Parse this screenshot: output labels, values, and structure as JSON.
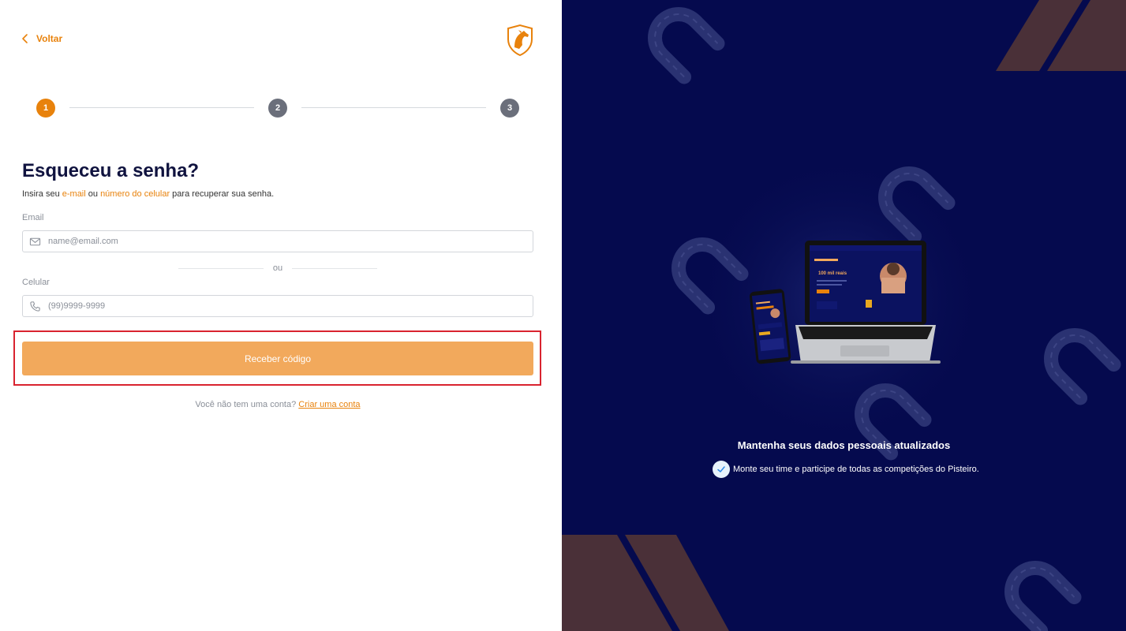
{
  "back": {
    "label": "Voltar"
  },
  "stepper": {
    "steps": [
      "1",
      "2",
      "3"
    ]
  },
  "form": {
    "title": "Esqueceu a senha?",
    "subtitle_prefix": "Insira seu ",
    "subtitle_email": "e-mail",
    "subtitle_or": " ou ",
    "subtitle_phone": "número do celular",
    "subtitle_suffix": " para recuperar sua senha.",
    "email_label": "Email",
    "email_placeholder": "name@email.com",
    "divider_text": "ou",
    "phone_label": "Celular",
    "phone_placeholder": "(99)9999-9999",
    "submit_label": "Receber código",
    "signup_prefix": "Você não tem uma conta?",
    "signup_link": "Criar uma conta"
  },
  "promo": {
    "title": "Mantenha seus dados pessoais atualizados",
    "item": "Monte seu time e participe de todas as competições do Pisteiro.",
    "mockup_headline": "100 mil reais"
  },
  "colors": {
    "accent": "#E8820C",
    "button": "#F2A95C",
    "navy": "#050A4E",
    "step_inactive": "#6B6F7B",
    "highlight": "#D9232F"
  },
  "icons": [
    "chevron-left-icon",
    "horse-logo-icon",
    "envelope-icon",
    "phone-icon",
    "check-icon",
    "horseshoe-icon"
  ]
}
